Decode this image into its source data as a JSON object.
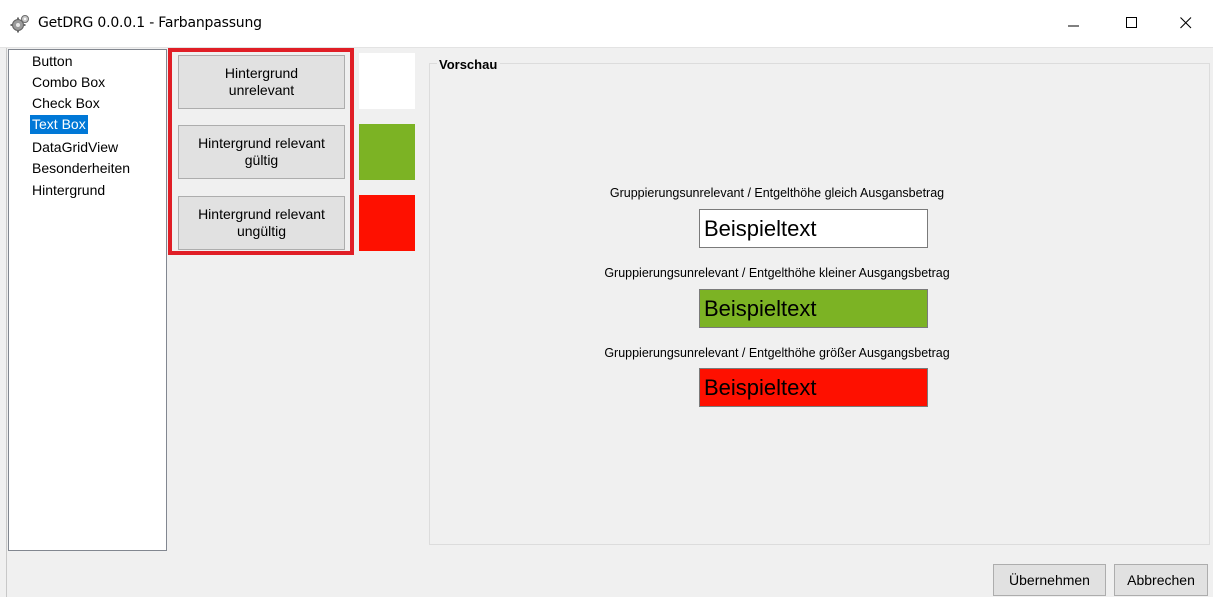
{
  "window": {
    "title": "GetDRG 0.0.0.1 - Farbanpassung",
    "icon": "gear-icon"
  },
  "sidebar": {
    "items": [
      {
        "label": "Button"
      },
      {
        "label": "Combo Box"
      },
      {
        "label": "Check Box"
      },
      {
        "label": "Text Box",
        "selected": true
      },
      {
        "label": "DataGridView"
      },
      {
        "label": "Besonderheiten"
      },
      {
        "label": "Hintergrund"
      }
    ]
  },
  "color_buttons": [
    {
      "label": "Hintergrund\nunrelevant",
      "color": "#ffffff"
    },
    {
      "label": "Hintergrund relevant\ngültig",
      "color": "#7cb324"
    },
    {
      "label": "Hintergrund relevant\nungültig",
      "color": "#fe1000"
    }
  ],
  "highlight_color": "#e01e26",
  "preview": {
    "title": "Vorschau",
    "items": [
      {
        "label": "Gruppierungsunrelevant / Entgelthöhe gleich Ausgansbetrag",
        "text": "Beispieltext",
        "color": "#ffffff"
      },
      {
        "label": "Gruppierungsunrelevant / Entgelthöhe kleiner Ausgangsbetrag",
        "text": "Beispieltext",
        "color": "#7cb324"
      },
      {
        "label": "Gruppierungsunrelevant / Entgelthöhe größer Ausgangsbetrag",
        "text": "Beispieltext",
        "color": "#fe1000"
      }
    ]
  },
  "footer": {
    "apply_label": "Übernehmen",
    "cancel_label": "Abbrechen"
  }
}
